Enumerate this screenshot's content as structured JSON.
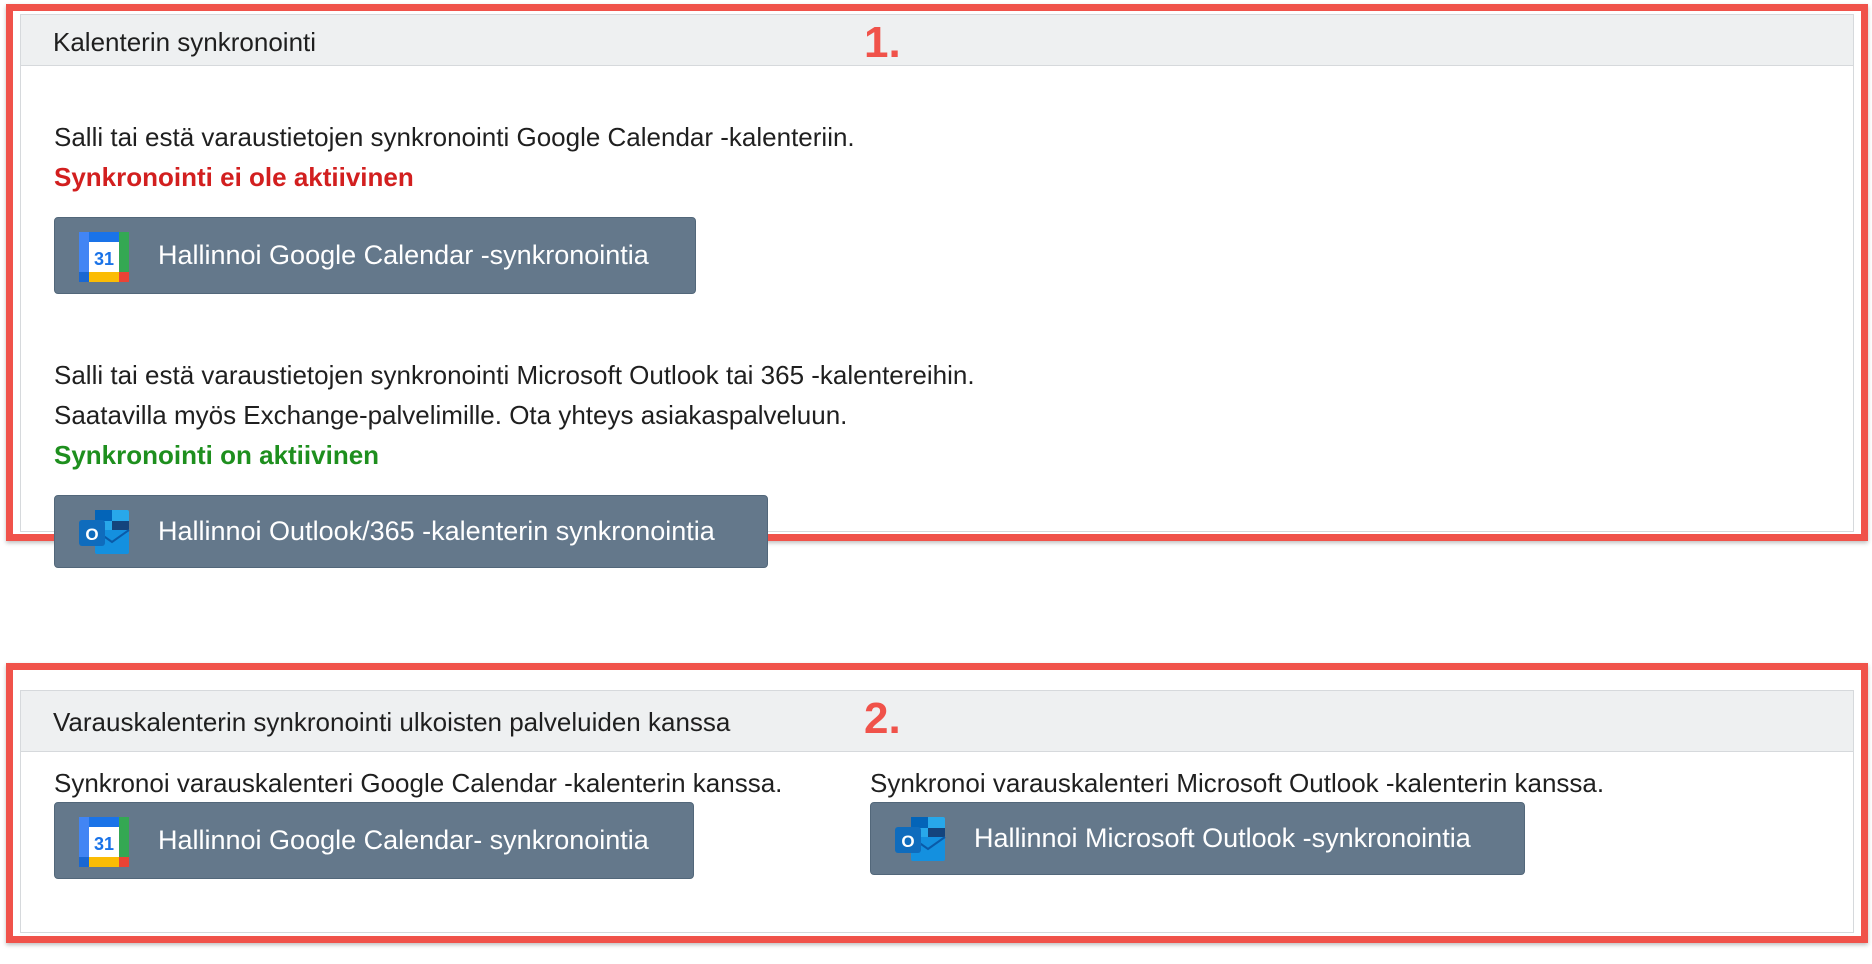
{
  "section1": {
    "step": "1.",
    "title": "Kalenterin synkronointi",
    "google": {
      "description": "Salli tai estä varaustietojen synkronointi Google Calendar -kalenteriin.",
      "status": "Synkronointi ei ole aktiivinen",
      "status_color": "#d21f1f",
      "button_label": "Hallinnoi Google Calendar -synkronointia",
      "icon_text": "31"
    },
    "outlook": {
      "description_line1": "Salli tai estä varaustietojen synkronointi Microsoft Outlook tai 365 -kalentereihin.",
      "description_line2": "Saatavilla myös Exchange-palvelimille. Ota yhteys asiakaspalveluun.",
      "status": "Synkronointi on aktiivinen",
      "status_color": "#1e8f1e",
      "button_label": "Hallinnoi Outlook/365 -kalenterin synkronointia",
      "icon_text": "O"
    }
  },
  "section2": {
    "step": "2.",
    "title": "Varauskalenterin synkronointi ulkoisten palveluiden kanssa",
    "google": {
      "description": "Synkronoi varauskalenteri Google Calendar -kalenterin kanssa.",
      "button_label": "Hallinnoi Google Calendar- synkronointia",
      "icon_text": "31"
    },
    "outlook": {
      "description": "Synkronoi varauskalenteri Microsoft Outlook -kalenterin kanssa.",
      "button_label": "Hallinnoi Microsoft Outlook -synkronointia",
      "icon_text": "O"
    }
  },
  "colors": {
    "annotation": "#f0524a",
    "button_bg": "#64788b",
    "header_bg": "#eef0f1"
  }
}
